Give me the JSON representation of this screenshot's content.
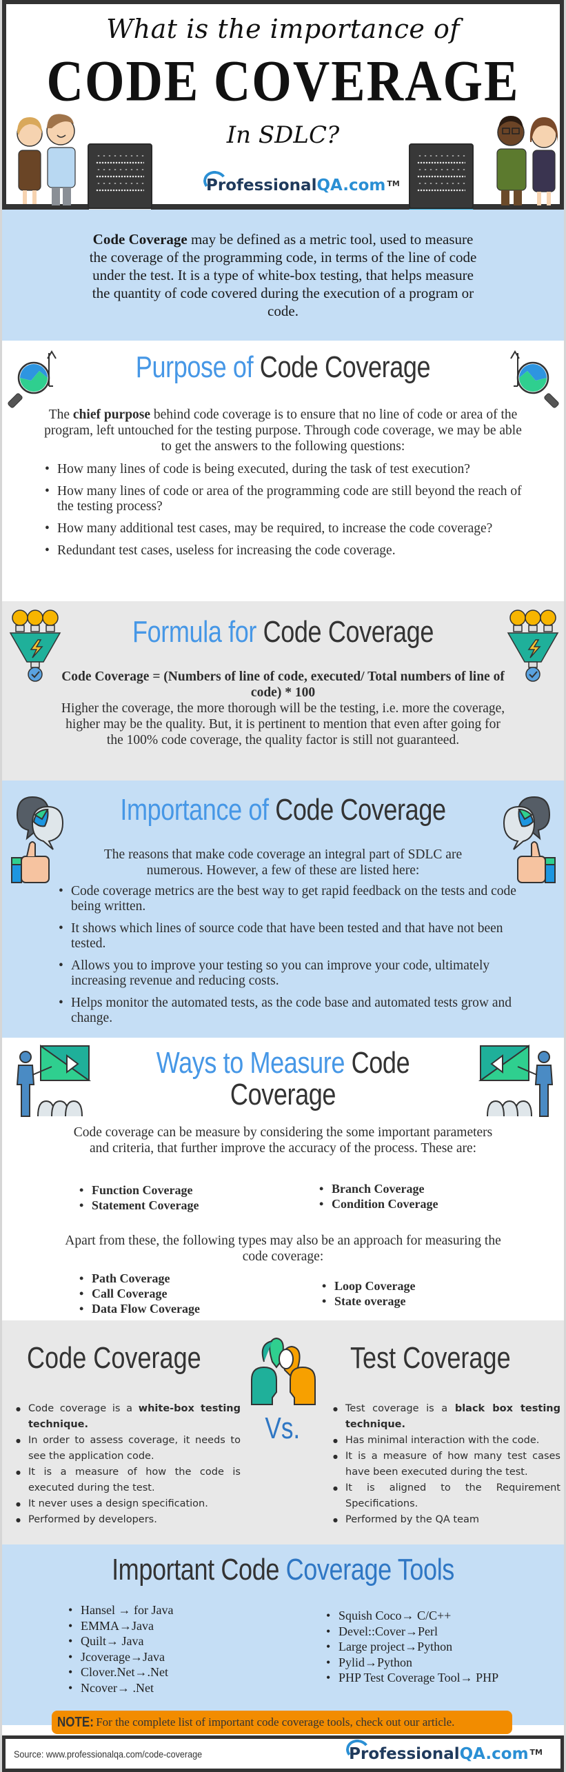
{
  "header": {
    "line1": "What is the importance of",
    "line2": "CODE COVERAGE",
    "line3": "In SDLC?",
    "logo": {
      "main": "Professional",
      "accent": "QA.com",
      "tm": "TM"
    }
  },
  "intro": {
    "bold": "Code Coverage",
    "text": " may be defined as a metric tool, used to measure the coverage of the programming code, in terms of the line of code under the test. It is a type of white-box testing, that helps measure the quantity of code covered during the execution of a program or code."
  },
  "purpose": {
    "title_accent": "Purpose of",
    "title_rest": " Code Coverage",
    "lead_pre": "The ",
    "lead_bold": "chief purpose",
    "lead_post": " behind code coverage is to ensure that no line of code or area of the program, left untouched for the testing purpose. Through code coverage, we may be able to get the answers to the following questions:",
    "items": [
      "How many lines of code is being executed, during the task of test execution?",
      "How many lines of code or area of the programming code are still beyond the reach of the testing process?",
      "How many additional test cases, may be required, to increase the code coverage?",
      "Redundant test cases, useless for increasing the code coverage."
    ]
  },
  "formula": {
    "title_accent": "Formula for",
    "title_rest": " Code Coverage",
    "equation": "Code Coverage = (Numbers of line of code, executed/ Total numbers of line of code) * 100",
    "text": "Higher the coverage, the more thorough will be the testing, i.e. more the coverage, higher may be the quality. But, it is pertinent to mention that even after going for the 100% code coverage, the quality factor is still not guaranteed."
  },
  "importance": {
    "title_accent": "Importance of",
    "title_rest": " Code Coverage",
    "lead": "The reasons that make code coverage an integral part of SDLC are numerous. However, a few of these are listed here:",
    "items": [
      "Code coverage metrics are the best way to get rapid feedback on the tests and code being written.",
      "It shows which lines of source code that have been tested and that have not been tested.",
      "Allows you to improve your testing so you can improve your code, ultimately increasing revenue and reducing costs.",
      "Helps monitor the automated tests, as the code base and automated tests grow and change."
    ]
  },
  "ways": {
    "title_accent": "Ways to Measure",
    "title_rest": " Code",
    "title_line2": "Coverage",
    "lead": "Code coverage can be measure by considering the some important parameters and criteria, that further improve the accuracy of the process. These are:",
    "primary_left": [
      "Function Coverage",
      "Statement Coverage"
    ],
    "primary_right": [
      "Branch Coverage",
      "Condition Coverage"
    ],
    "after": "Apart from these, the following types may also be an approach for measuring the code coverage:",
    "extra_left": [
      "Path Coverage",
      "Call Coverage",
      "Data Flow Coverage"
    ],
    "extra_right": [
      "Loop Coverage",
      "State overage"
    ]
  },
  "versus": {
    "left_title": "Code Coverage",
    "right_title": "Test Coverage",
    "vs": "Vs.",
    "left_items": [
      {
        "pre": "Code coverage is a ",
        "bold": "white-box testing technique.",
        "post": ""
      },
      {
        "pre": "In order to assess coverage, it needs to see the application code.",
        "bold": "",
        "post": ""
      },
      {
        "pre": "It is a measure of how the code is executed during the test.",
        "bold": "",
        "post": ""
      },
      {
        "pre": "It never uses a design specification.",
        "bold": "",
        "post": ""
      },
      {
        "pre": "Performed by developers.",
        "bold": "",
        "post": ""
      }
    ],
    "right_items": [
      {
        "pre": "Test coverage is a ",
        "bold": "black box testing technique.",
        "post": ""
      },
      {
        "pre": "Has minimal interaction with the code.",
        "bold": "",
        "post": ""
      },
      {
        "pre": "It is a measure of how many test cases have been executed during the test.",
        "bold": "",
        "post": ""
      },
      {
        "pre": "It is aligned to the Requirement Specifications.",
        "bold": "",
        "post": ""
      },
      {
        "pre": "Performed by the QA team",
        "bold": "",
        "post": ""
      }
    ]
  },
  "tools": {
    "title_rest": "Important Code ",
    "title_accent": "Coverage Tools",
    "left": [
      "Hansel → for Java",
      "EMMA→Java",
      "Quilt→ Java",
      "Jcoverage→Java",
      "Clover.Net→.Net",
      "Ncover→ .Net"
    ],
    "right": [
      "Squish Coco→ C/C++",
      "Devel::Cover→Perl",
      "Large project→Python",
      "Pylid→Python",
      "PHP Test Coverage Tool→ PHP"
    ],
    "note_label": "NOTE:",
    "note_text": " For the complete list of important code coverage tools, check out our article."
  },
  "footer": {
    "source": "Source: www.professionalqa.com/code-coverage",
    "logo": {
      "main": "Professional",
      "accent": "QA.com",
      "tm": "TM"
    }
  },
  "colors": {
    "accent_blue": "#4697e6",
    "deep_blue": "#2f77c4",
    "light_blue_bg": "#c5def5",
    "grey_bg": "#e8e8e8",
    "note_orange": "#f28c00"
  }
}
